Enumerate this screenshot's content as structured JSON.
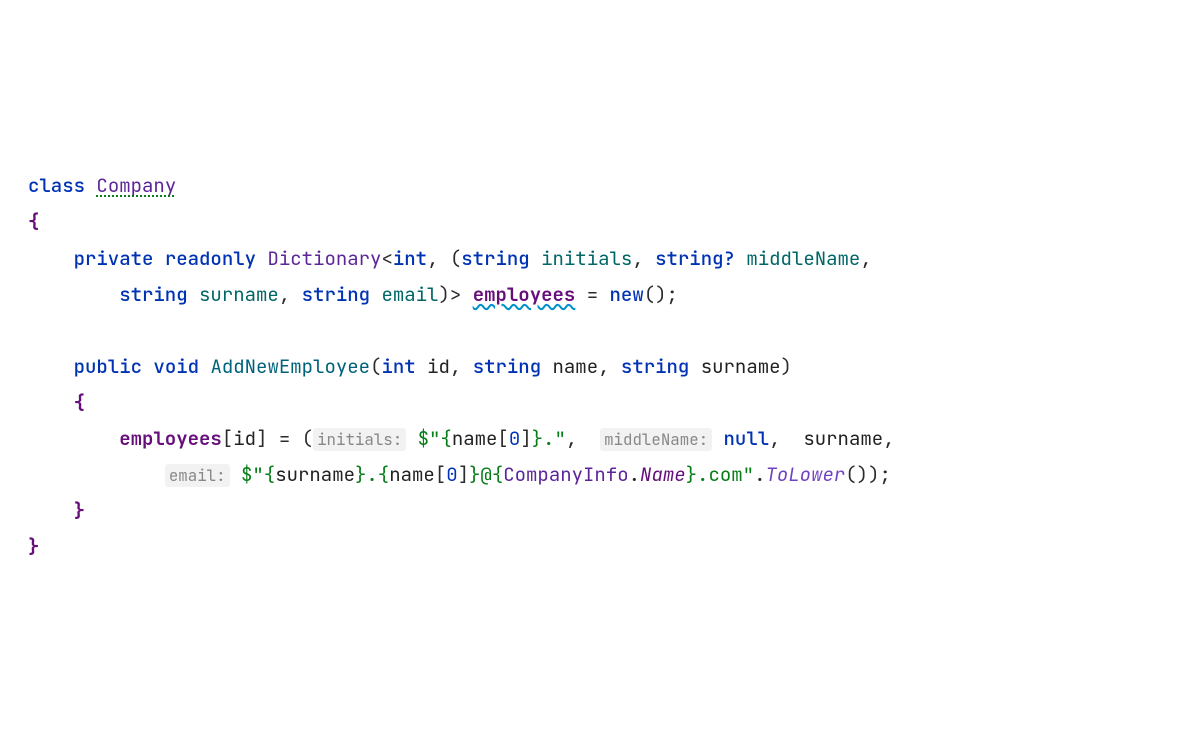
{
  "code": {
    "kw_class": "class",
    "class_name": "Company",
    "lbrace": "{",
    "rbrace": "}",
    "field": {
      "kw_private": "private",
      "kw_readonly": "readonly",
      "type_dict": "Dictionary",
      "lt": "<",
      "type_int": "int",
      "comma": ",",
      "lparen": "(",
      "type_string": "string",
      "mem_initials": "initials",
      "type_string_q": "string?",
      "mem_middleName": "middleName",
      "mem_surname": "surname",
      "mem_email": "email",
      "rparen": ")",
      "gt": ">",
      "name": "employees",
      "eq": "=",
      "kw_new": "new",
      "ctor_parens": "()",
      "semi": ";"
    },
    "method": {
      "kw_public": "public",
      "kw_void": "void",
      "name": "AddNewEmployee",
      "lparen": "(",
      "p1_type": "int",
      "p1_name": "id",
      "p2_type": "string",
      "p2_name": "name",
      "p3_type": "string",
      "p3_name": "surname",
      "rparen": ")",
      "lbrace": "{",
      "rbrace": "}"
    },
    "body": {
      "target": "employees",
      "lbrack": "[",
      "idx": "id",
      "rbrack": "]",
      "eq": "=",
      "lparen": "(",
      "hint_initials": "initials:",
      "str1_pre": "$\"{",
      "str1_name": "name",
      "str1_idx": "[",
      "str1_zero": "0",
      "str1_idx2": "]",
      "str1_suf": "}.\"",
      "comma": ",",
      "hint_middle": "middleName:",
      "kw_null": "null",
      "arg_surname": "surname",
      "hint_email": "email:",
      "str2_pre": "$\"{",
      "str2_surname": "surname",
      "str2_mid1": "}.{",
      "str2_name": "name",
      "str2_idx": "[",
      "str2_zero": "0",
      "str2_idx2": "]",
      "str2_mid2": "}@{",
      "str2_ci": "CompanyInfo",
      "str2_dot": ".",
      "str2_prop": "Name",
      "str2_suf": "}.com\"",
      "dot": ".",
      "tolower": "ToLower",
      "call": "()",
      "rparen": ")",
      "semi": ";"
    }
  }
}
